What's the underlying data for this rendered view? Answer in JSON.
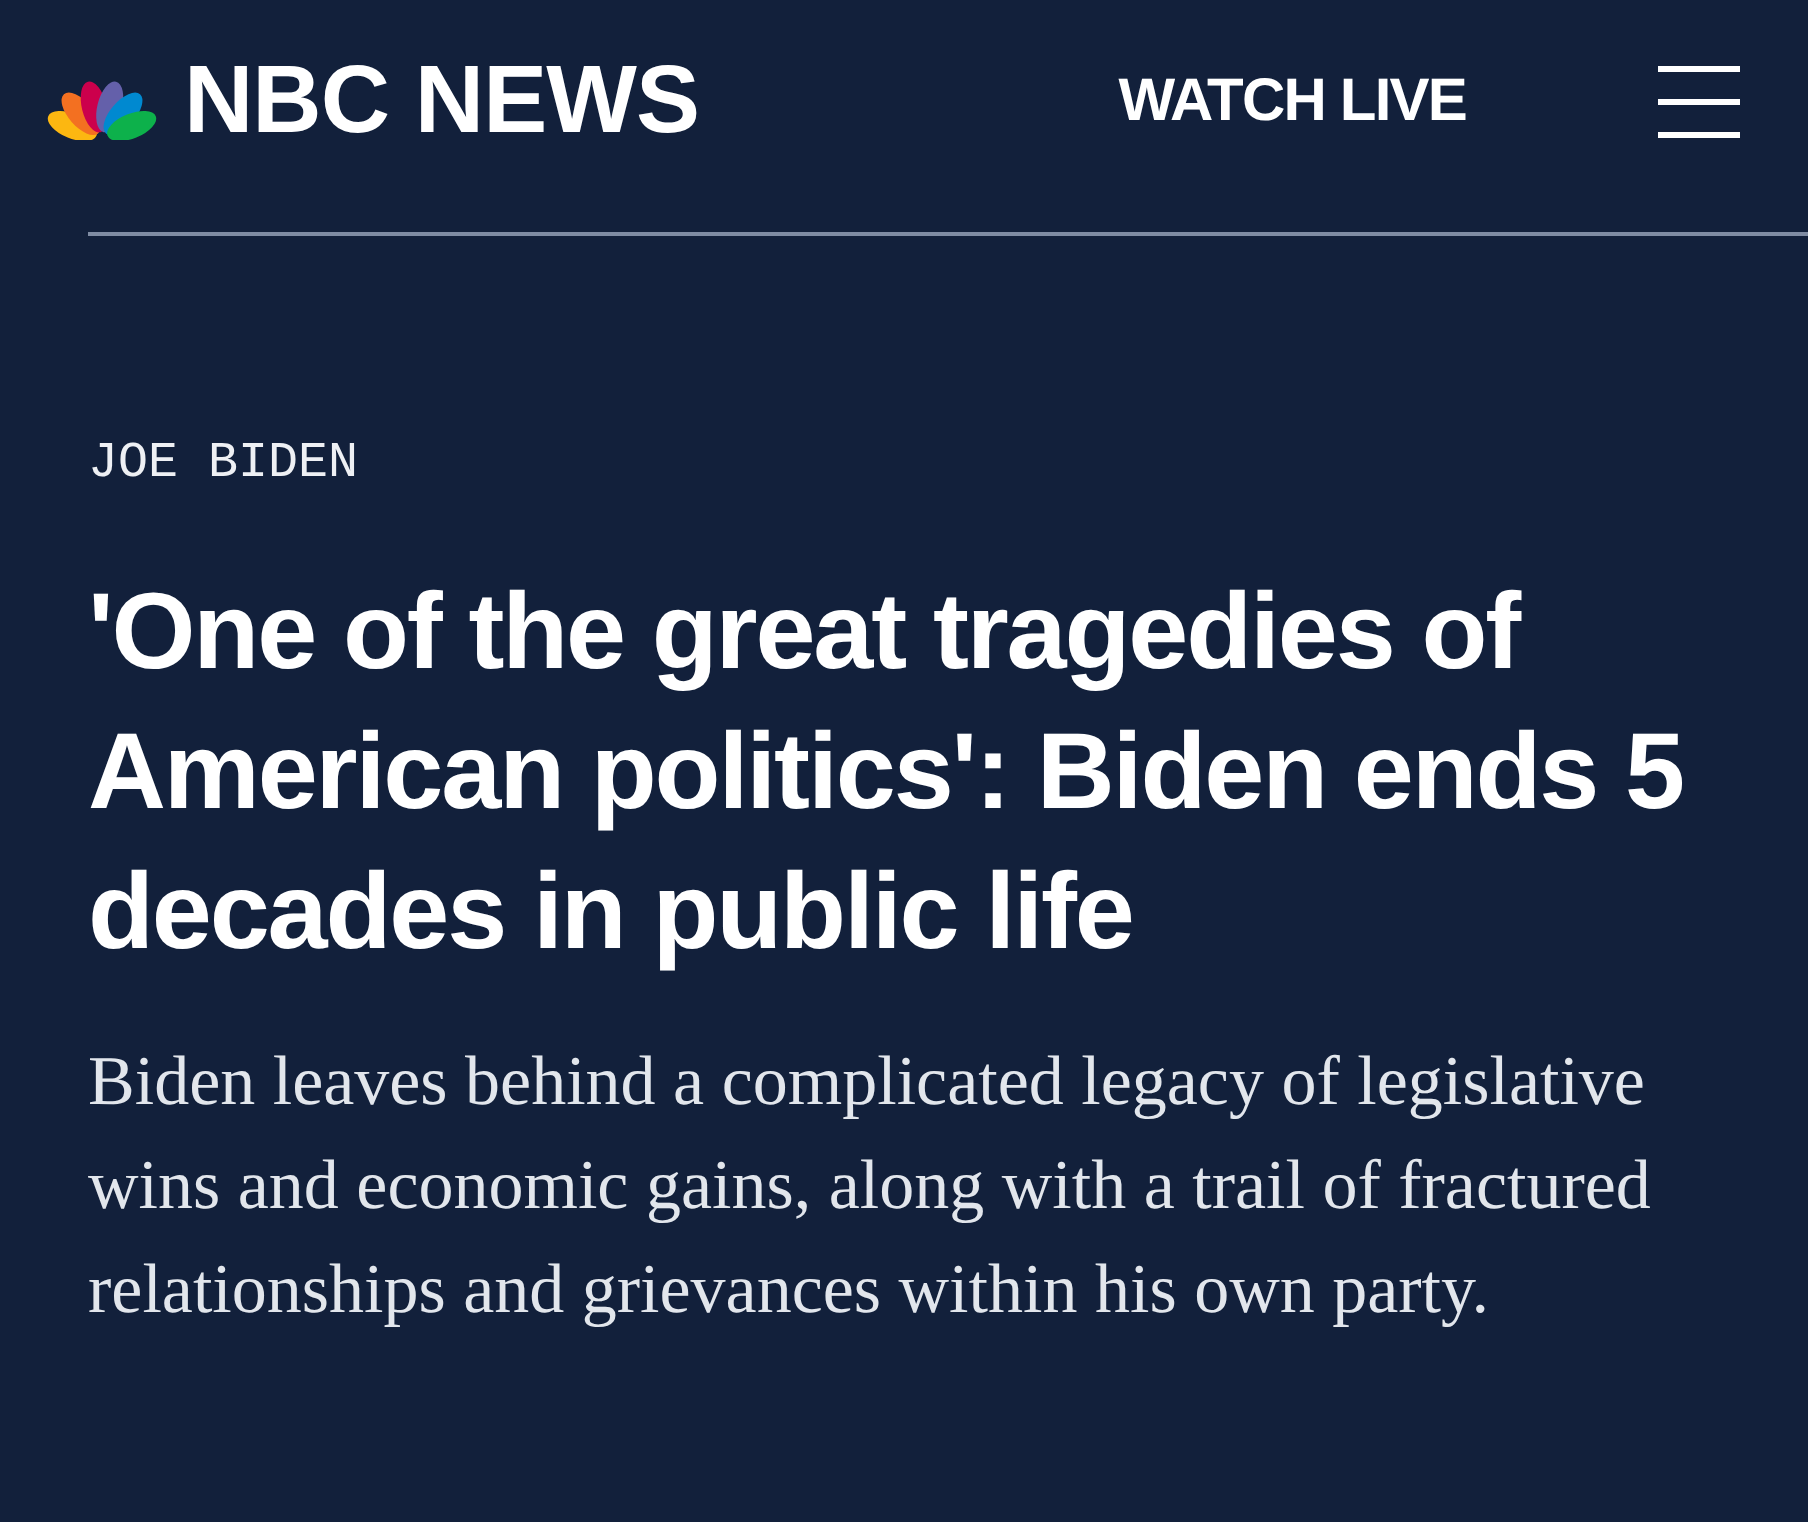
{
  "header": {
    "brand": "NBC NEWS",
    "watch_live": "WATCH LIVE"
  },
  "article": {
    "category": "JOE BIDEN",
    "headline": "'One of the great tragedies of American politics': Biden ends 5 decades in public life",
    "deck": "Biden leaves behind a complicated legacy of legislative wins and economic gains, along with a trail of fractured relationships and grievances within his own party."
  }
}
